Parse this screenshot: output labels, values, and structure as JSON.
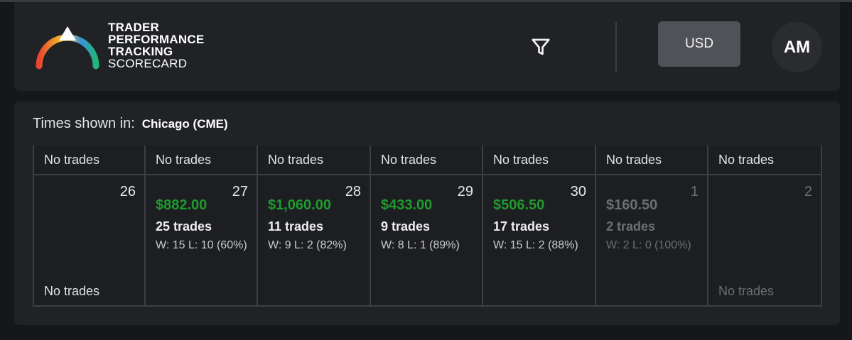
{
  "brand": {
    "line1": "TRADER",
    "line2": "PERFORMANCE",
    "line3": "TRACKING",
    "line4": "SCORECARD"
  },
  "header": {
    "currency_label": "USD",
    "avatar_initials": "AM",
    "filter_icon": "filter-icon"
  },
  "timezone": {
    "label": "Times shown in:",
    "value": "Chicago (CME)"
  },
  "calendar": {
    "top_row": [
      "No trades",
      "No trades",
      "No trades",
      "No trades",
      "No trades",
      "No trades",
      "No trades"
    ],
    "days": [
      {
        "day": "26",
        "pnl": "",
        "trades": "",
        "wl": "",
        "bottom": "No trades"
      },
      {
        "day": "27",
        "pnl": "$882.00",
        "trades": "25 trades",
        "wl": "W: 15  L: 10 (60%)",
        "bottom": ""
      },
      {
        "day": "28",
        "pnl": "$1,060.00",
        "trades": "11 trades",
        "wl": "W: 9  L: 2  (82%)",
        "bottom": ""
      },
      {
        "day": "29",
        "pnl": "$433.00",
        "trades": "9 trades",
        "wl": "W: 8  L: 1  (89%)",
        "bottom": ""
      },
      {
        "day": "30",
        "pnl": "$506.50",
        "trades": "17 trades",
        "wl": "W: 15  L: 2  (88%)",
        "bottom": ""
      },
      {
        "day": "1",
        "pnl": "$160.50",
        "trades": "2 trades",
        "wl": "W: 2  L: 0  (100%)",
        "bottom": ""
      },
      {
        "day": "2",
        "pnl": "",
        "trades": "",
        "wl": "",
        "bottom": "No trades"
      }
    ]
  },
  "colors": {
    "profit": "#1f9a2d",
    "background": "#16171a",
    "card": "#202226"
  }
}
